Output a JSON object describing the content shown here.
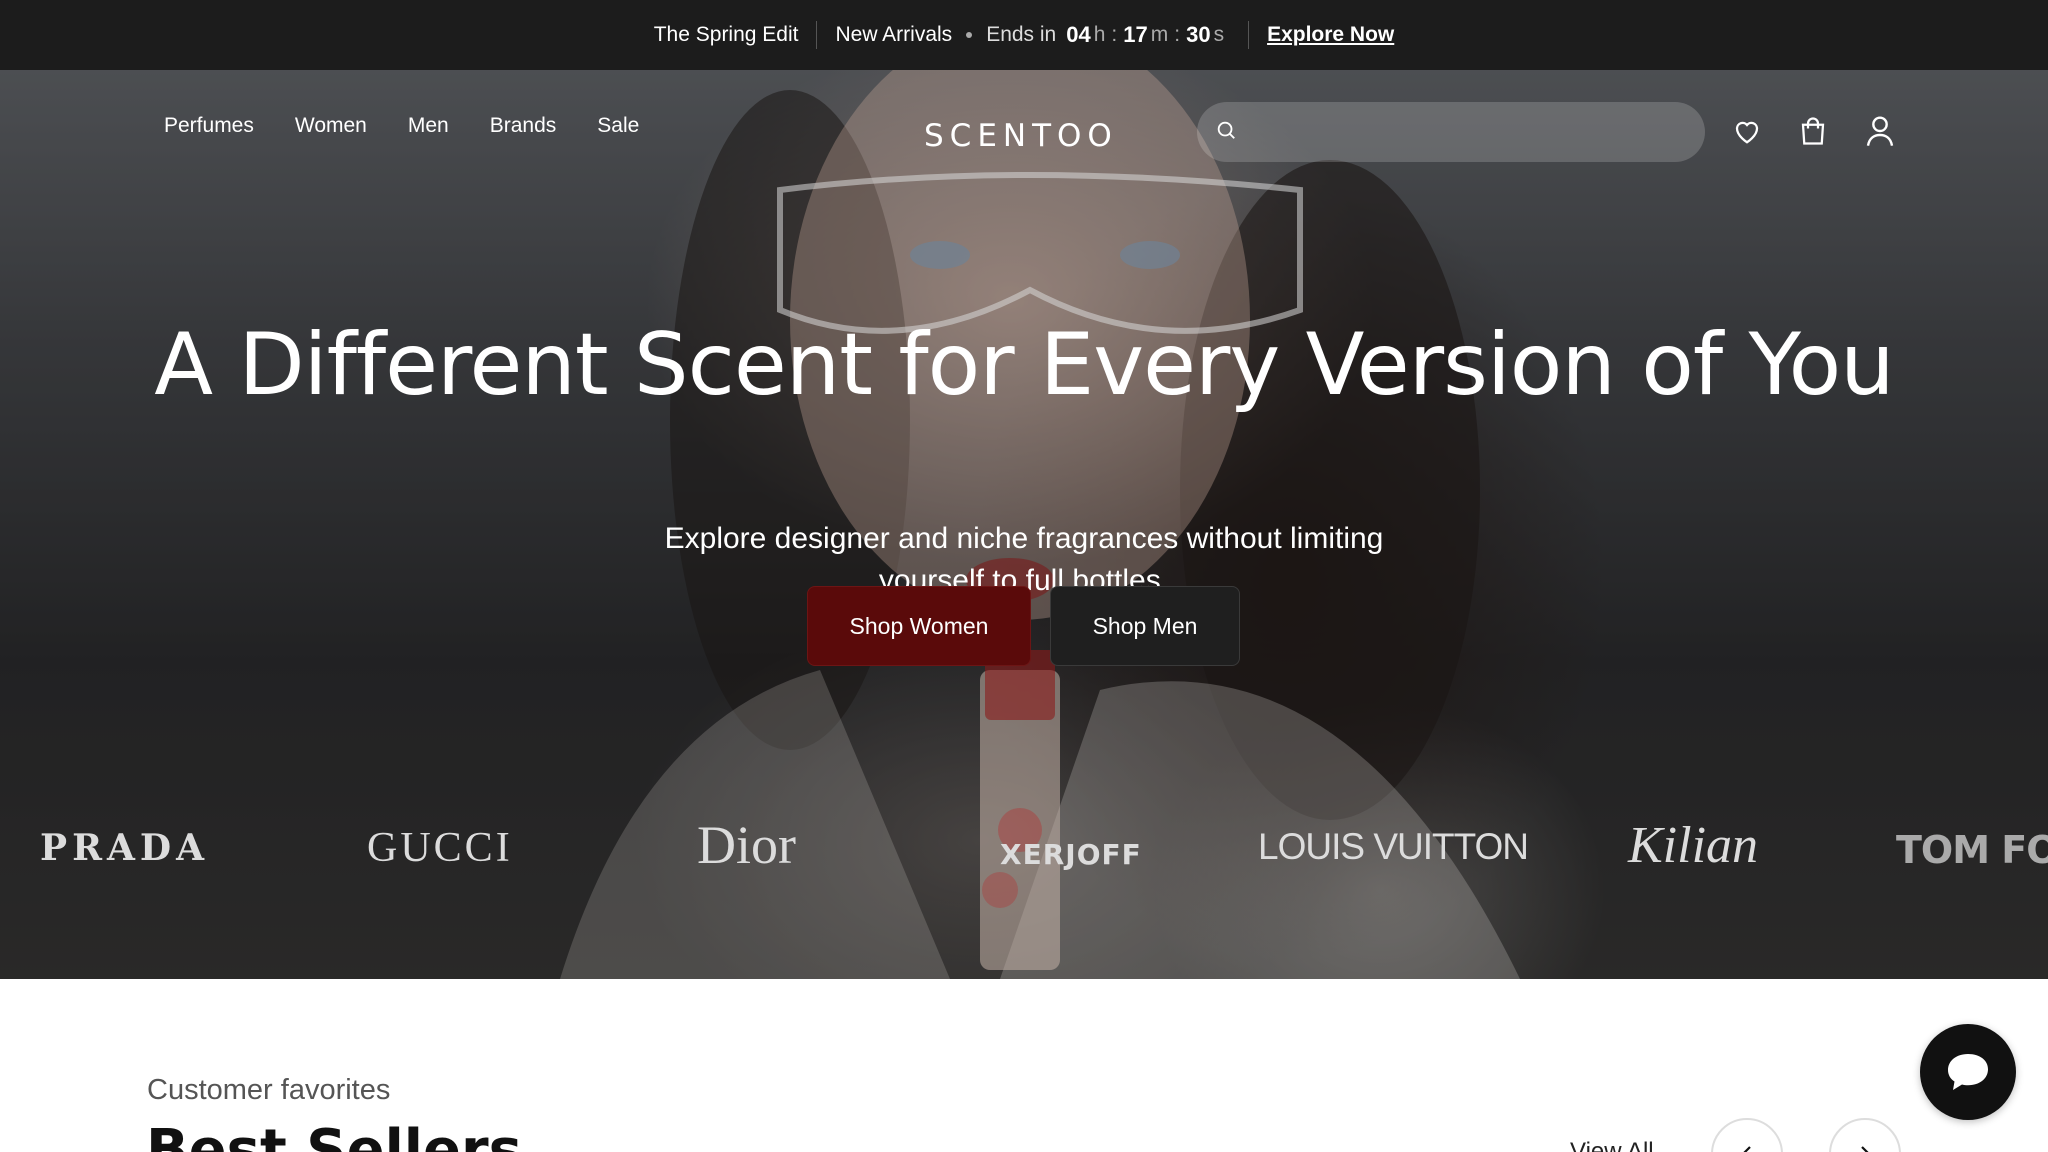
{
  "announcement": {
    "collection": "The Spring Edit",
    "label": "New Arrivals",
    "ends_in": "Ends in",
    "countdown": {
      "hours": "04",
      "h": "h",
      "minutes": "17",
      "m": "m",
      "seconds": "30",
      "s": "s"
    },
    "cta": "Explore Now"
  },
  "nav": {
    "links": [
      "Perfumes",
      "Women",
      "Men",
      "Brands",
      "Sale"
    ],
    "logo": "SCENTOO",
    "search_placeholder": "",
    "icons": [
      "heart-icon",
      "bag-icon",
      "user-icon"
    ]
  },
  "hero": {
    "headline": "A Different Scent for Every Version of You",
    "subheadline": "Explore designer and niche fragrances without limiting yourself to full bottles.",
    "primary_cta": "Shop Women",
    "secondary_cta": "Shop Men",
    "brands": [
      "PRADA",
      "GUCCI",
      "Dior",
      "XERJOFF",
      "LOUIS VUITTON",
      "Kilian",
      "TOM FO"
    ]
  },
  "best_sellers": {
    "eyebrow": "Customer favorites",
    "title": "Best Sellers",
    "view_all": "View All"
  },
  "colors": {
    "announcement_bg": "#1c1c1c",
    "primary_button": "#5a0a0a",
    "secondary_button": "#1f1f1f",
    "chat_button": "#111111"
  }
}
